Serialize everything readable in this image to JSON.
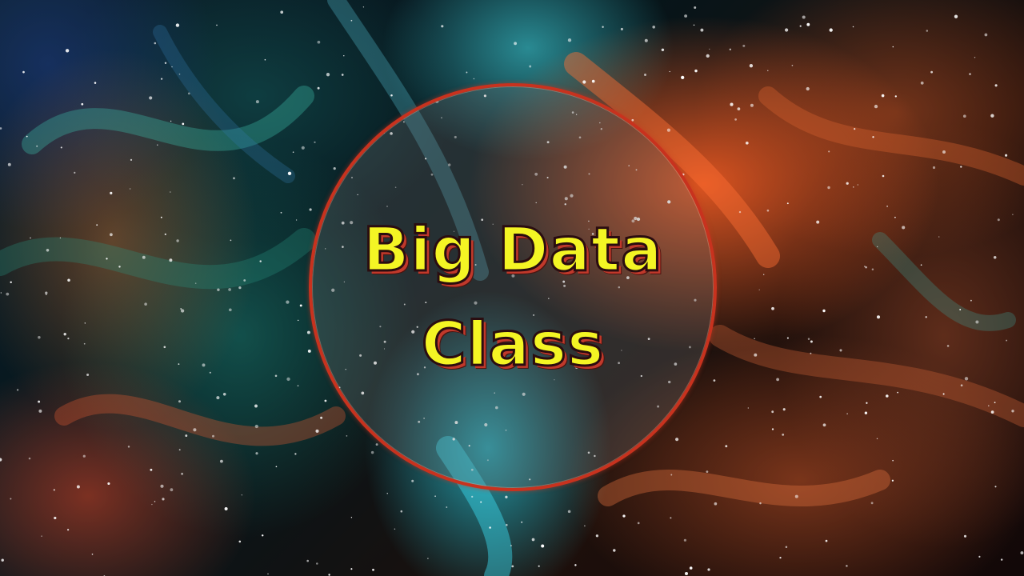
{
  "emblem": {
    "title_line_1": "Big Data",
    "title_line_2": "Class"
  },
  "colors": {
    "title_fill": "#f4f524",
    "title_shadow": "#c0392b",
    "ring_border": "#c8321e"
  }
}
